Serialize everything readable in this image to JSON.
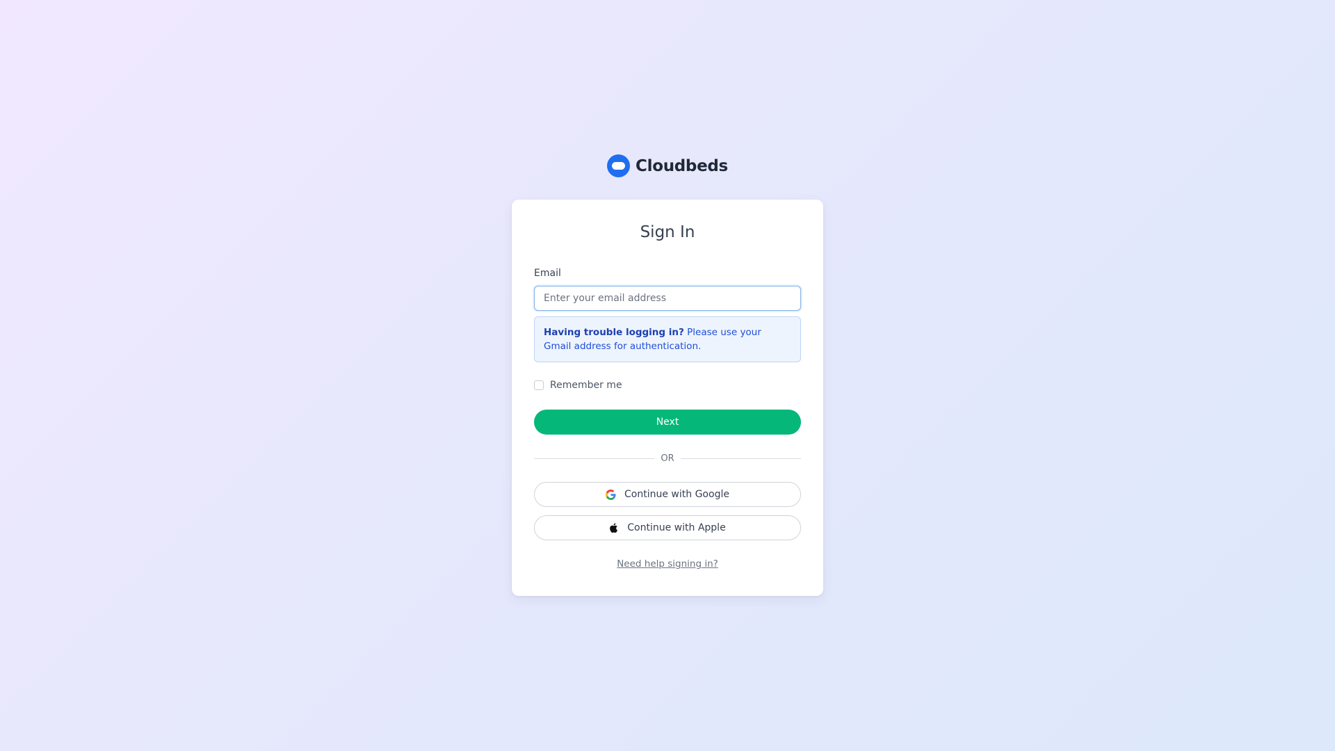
{
  "brand": {
    "name": "Cloudbeds",
    "logo_icon": "cloudbeds-logo-icon",
    "accent_color": "#1f6ef0"
  },
  "signin": {
    "title": "Sign In",
    "email_label": "Email",
    "email_placeholder": "Enter your email address",
    "email_value": "",
    "notice_bold": "Having trouble logging in?",
    "notice_text": " Please use your Gmail address for authentication.",
    "remember_label": "Remember me",
    "remember_checked": false,
    "next_label": "Next",
    "next_color": "#05b87a",
    "divider_text": "OR",
    "google_label": "Continue with Google",
    "google_icon": "google-icon",
    "apple_label": "Continue with Apple",
    "apple_icon": "apple-icon",
    "help_link": "Need help signing in?"
  }
}
